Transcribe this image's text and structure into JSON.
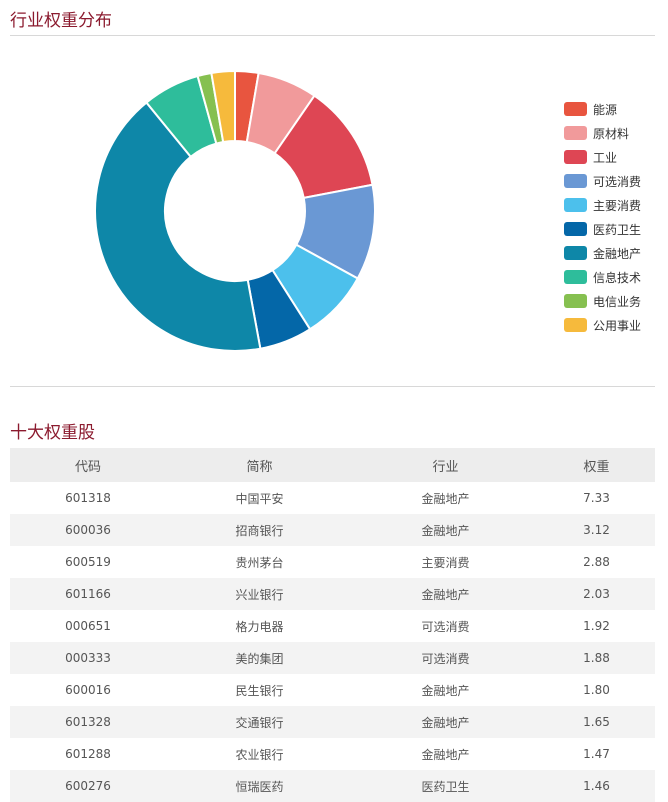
{
  "industry_section": {
    "title": "行业权重分布"
  },
  "chart_data": {
    "type": "pie",
    "donut": true,
    "categories": [
      "能源",
      "原材料",
      "工业",
      "可选消费",
      "主要消费",
      "医药卫生",
      "金融地产",
      "信息技术",
      "电信业务",
      "公用事业"
    ],
    "values": [
      2.7,
      6.9,
      12.4,
      11.0,
      8.0,
      6.1,
      42.0,
      6.6,
      1.6,
      2.7
    ],
    "colors": [
      "#e8553f",
      "#f19a9b",
      "#de4654",
      "#6a98d4",
      "#4cc0ec",
      "#0467a8",
      "#0e87a8",
      "#2ebd9b",
      "#86c050",
      "#f6ba3c"
    ],
    "legend_position": "right"
  },
  "top10_section": {
    "title": "十大权重股",
    "columns": [
      "代码",
      "简称",
      "行业",
      "权重"
    ],
    "rows": [
      [
        "601318",
        "中国平安",
        "金融地产",
        "7.33"
      ],
      [
        "600036",
        "招商银行",
        "金融地产",
        "3.12"
      ],
      [
        "600519",
        "贵州茅台",
        "主要消费",
        "2.88"
      ],
      [
        "601166",
        "兴业银行",
        "金融地产",
        "2.03"
      ],
      [
        "000651",
        "格力电器",
        "可选消费",
        "1.92"
      ],
      [
        "000333",
        "美的集团",
        "可选消费",
        "1.88"
      ],
      [
        "600016",
        "民生银行",
        "金融地产",
        "1.80"
      ],
      [
        "601328",
        "交通银行",
        "金融地产",
        "1.65"
      ],
      [
        "601288",
        "农业银行",
        "金融地产",
        "1.47"
      ],
      [
        "600276",
        "恒瑞医药",
        "医药卫生",
        "1.46"
      ]
    ]
  }
}
